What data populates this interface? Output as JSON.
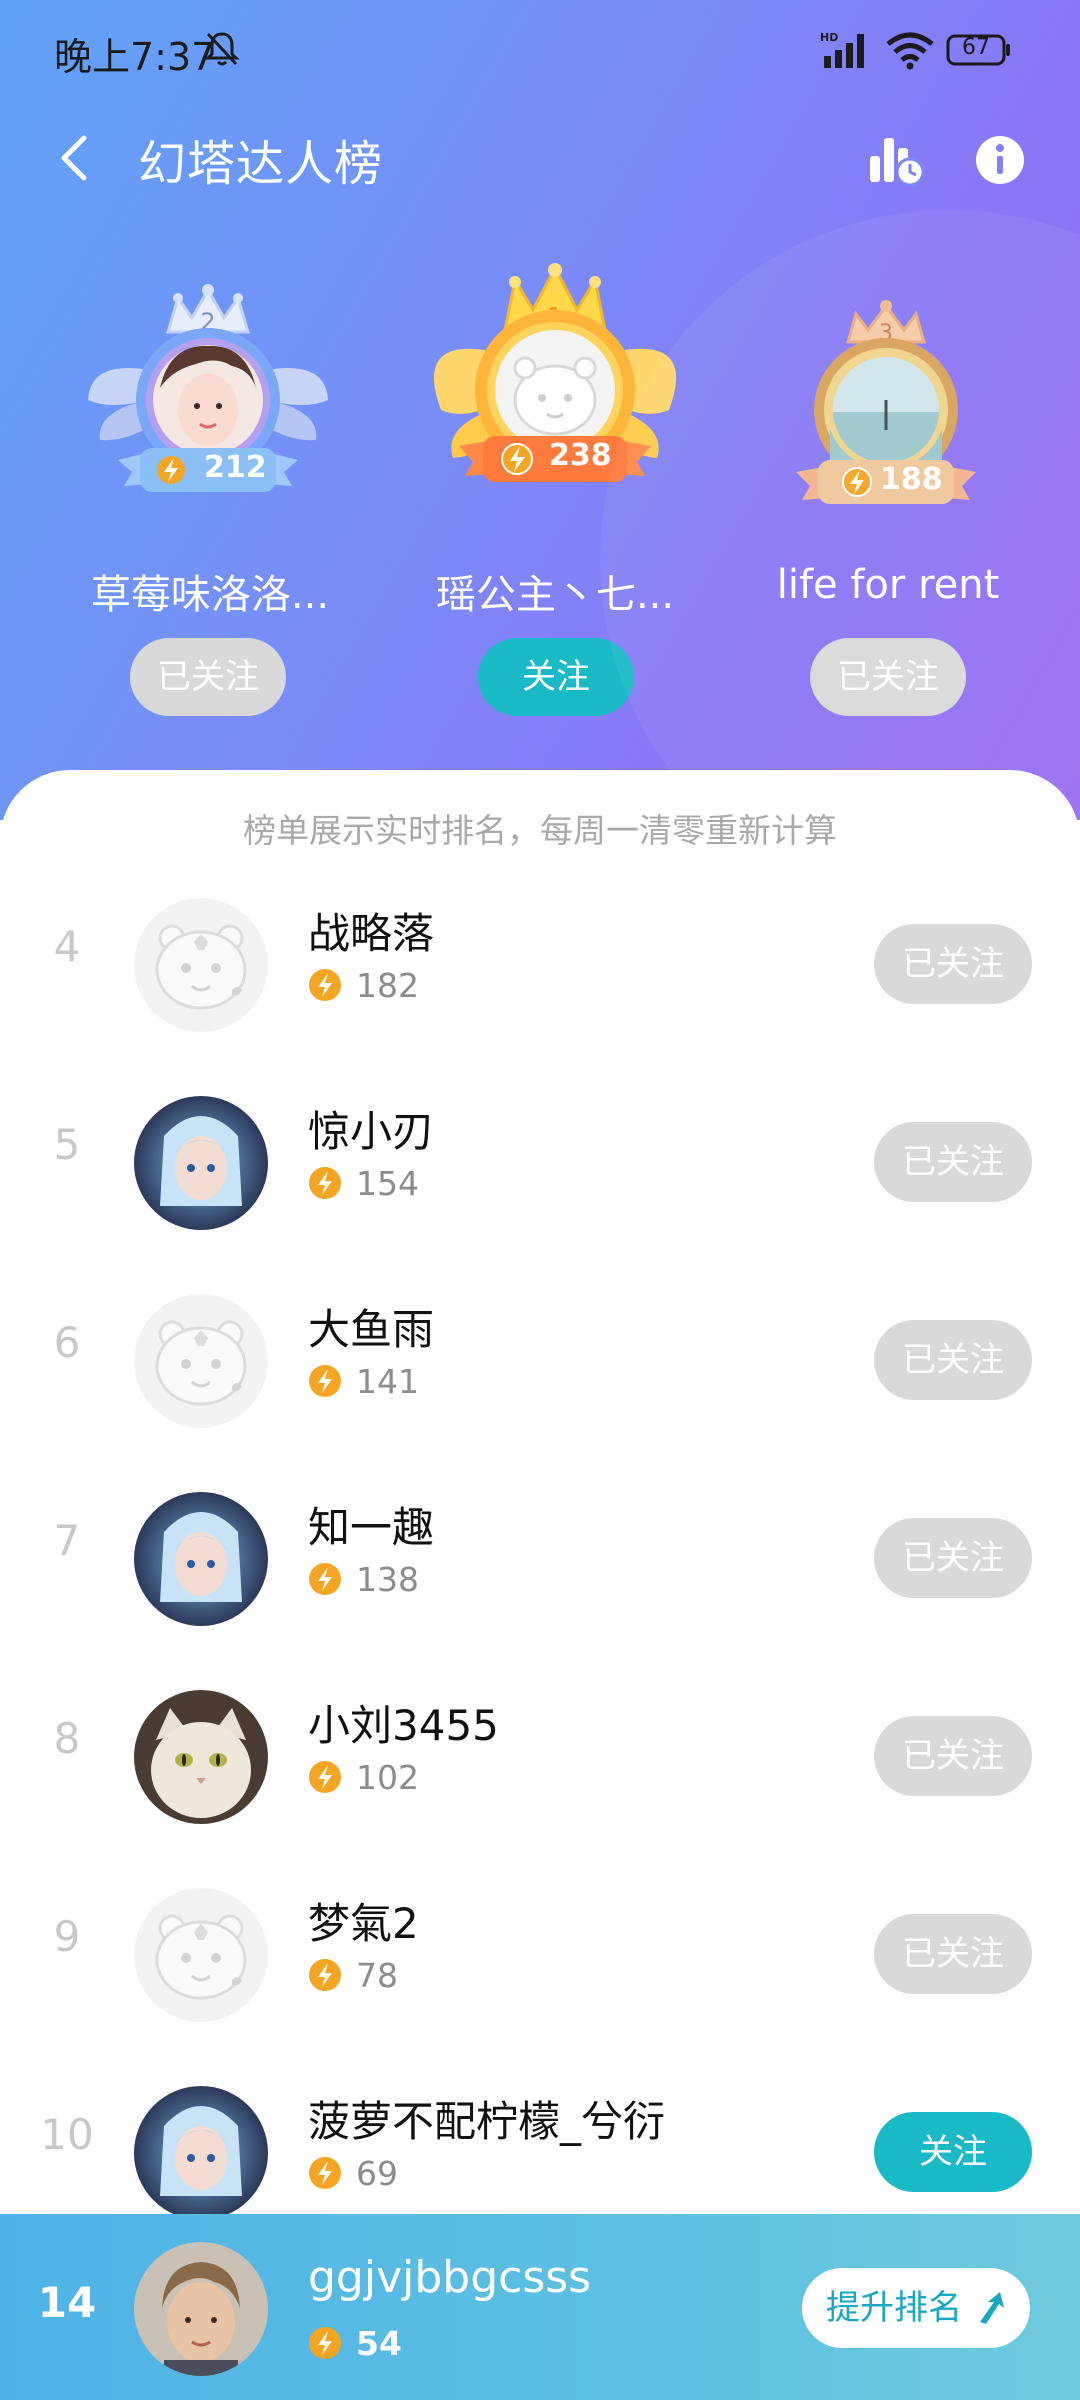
{
  "status_bar": {
    "time": "晚上7:37",
    "battery": "67"
  },
  "header": {
    "title": "幻塔达人榜"
  },
  "podium": [
    {
      "rank": "2",
      "name": "草莓味洛洛...",
      "score": "212",
      "button": "已关注",
      "followed": true
    },
    {
      "rank": "1",
      "name": "瑶公主丶七...",
      "score": "238",
      "button": "关注",
      "followed": false
    },
    {
      "rank": "3",
      "name": "life for rent",
      "score": "188",
      "button": "已关注",
      "followed": true
    }
  ],
  "notice": "榜单展示实时排名，每周一清零重新计算",
  "list": [
    {
      "rank": "4",
      "name": "战略落",
      "score": "182",
      "button": "已关注",
      "followed": true,
      "avatar": "default-avatar"
    },
    {
      "rank": "5",
      "name": "惊小刃",
      "score": "154",
      "button": "已关注",
      "followed": true,
      "avatar": "anime-avatar"
    },
    {
      "rank": "6",
      "name": "大鱼雨",
      "score": "141",
      "button": "已关注",
      "followed": true,
      "avatar": "default-avatar"
    },
    {
      "rank": "7",
      "name": "知一趣",
      "score": "138",
      "button": "已关注",
      "followed": true,
      "avatar": "anime-avatar"
    },
    {
      "rank": "8",
      "name": "小刘3455",
      "score": "102",
      "button": "已关注",
      "followed": true,
      "avatar": "cat-avatar"
    },
    {
      "rank": "9",
      "name": "梦氣2",
      "score": "78",
      "button": "已关注",
      "followed": true,
      "avatar": "default-avatar"
    },
    {
      "rank": "10",
      "name": "菠萝不配柠檬_兮衍",
      "score": "69",
      "button": "关注",
      "followed": false,
      "avatar": "anime-avatar"
    }
  ],
  "self": {
    "rank": "14",
    "name": "ggjvjbbgcsss",
    "score": "54",
    "boost_label": "提升排名"
  },
  "colors": {
    "accent": "#19b9c6",
    "bolt": "#f4a522",
    "followed_btn": "#d9d9d9"
  }
}
